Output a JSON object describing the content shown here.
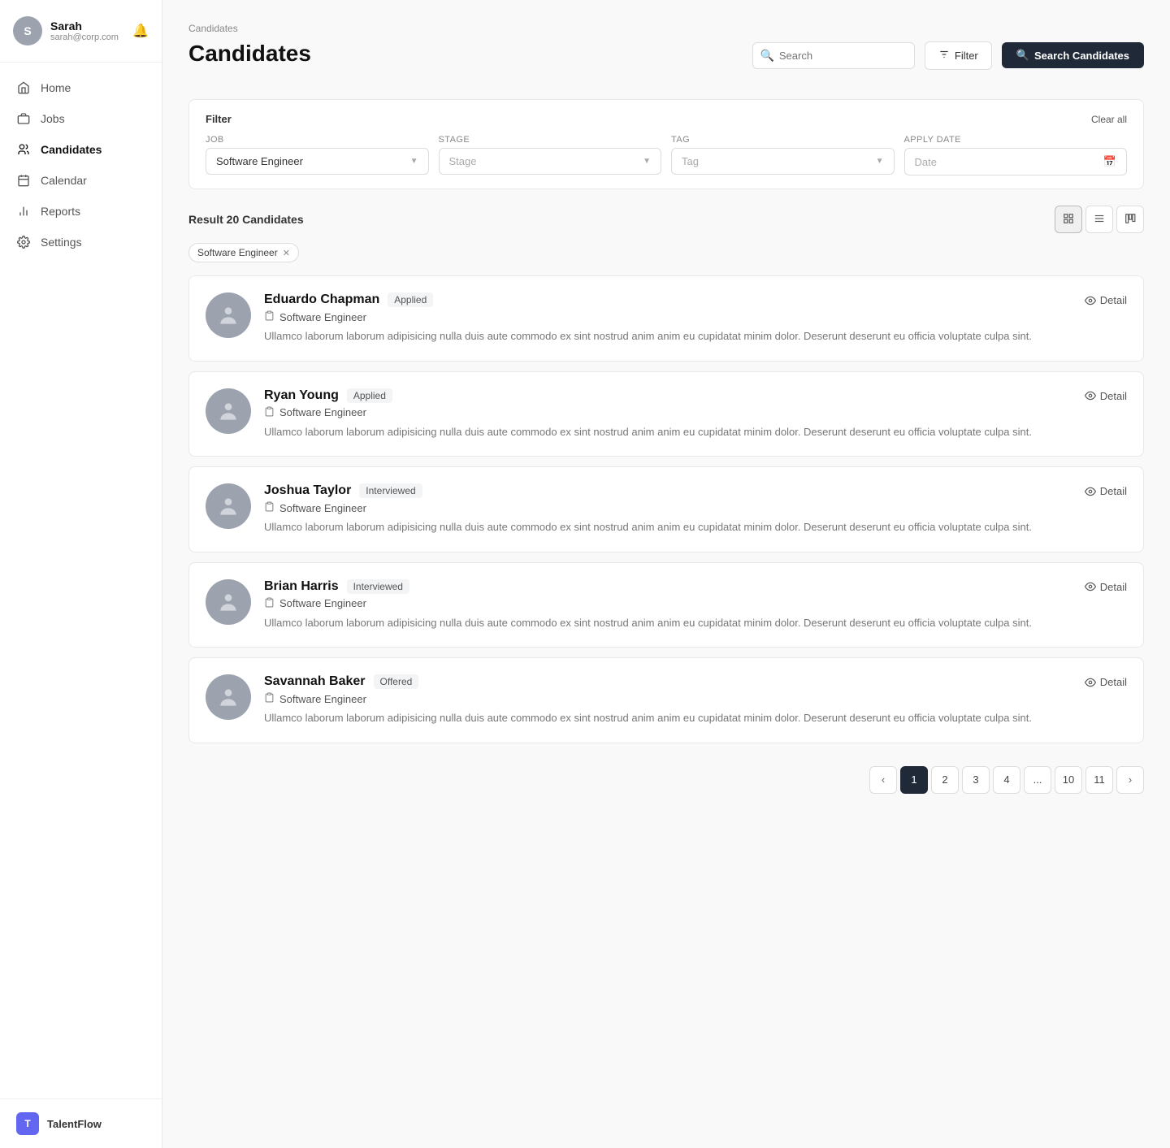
{
  "app": {
    "name": "TalentFlow",
    "logo_letter": "T"
  },
  "user": {
    "name": "Sarah",
    "email": "sarah@corp.com",
    "avatar_letter": "S"
  },
  "sidebar": {
    "items": [
      {
        "id": "home",
        "label": "Home",
        "icon": "home"
      },
      {
        "id": "jobs",
        "label": "Jobs",
        "icon": "briefcase"
      },
      {
        "id": "candidates",
        "label": "Candidates",
        "icon": "candidates",
        "active": true
      },
      {
        "id": "calendar",
        "label": "Calendar",
        "icon": "calendar"
      },
      {
        "id": "reports",
        "label": "Reports",
        "icon": "reports"
      },
      {
        "id": "settings",
        "label": "Settings",
        "icon": "settings"
      }
    ]
  },
  "header": {
    "breadcrumb": "Candidates",
    "title": "Candidates"
  },
  "toolbar": {
    "search_placeholder": "Search",
    "filter_label": "Filter",
    "search_candidates_label": "Search Candidates"
  },
  "filter": {
    "label": "Filter",
    "clear_all": "Clear all",
    "fields": [
      {
        "id": "job",
        "label": "Job",
        "value": "Software Engineer",
        "placeholder": ""
      },
      {
        "id": "stage",
        "label": "Stage",
        "value": "",
        "placeholder": "Stage"
      },
      {
        "id": "tag",
        "label": "Tag",
        "value": "",
        "placeholder": "Tag"
      },
      {
        "id": "apply_date",
        "label": "Apply Date",
        "value": "",
        "placeholder": "Date"
      }
    ]
  },
  "results": {
    "text": "Result 20 Candidates",
    "active_filters": [
      {
        "label": "Software Engineer"
      }
    ]
  },
  "candidates": [
    {
      "name": "Eduardo Chapman",
      "status": "Applied",
      "job": "Software Engineer",
      "bio": "Ullamco laborum laborum adipisicing nulla duis aute commodo ex sint nostrud anim anim eu cupidatat minim dolor. Deserunt deserunt eu officia voluptate culpa sint."
    },
    {
      "name": "Ryan Young",
      "status": "Applied",
      "job": "Software Engineer",
      "bio": "Ullamco laborum laborum adipisicing nulla duis aute commodo ex sint nostrud anim anim eu cupidatat minim dolor. Deserunt deserunt eu officia voluptate culpa sint."
    },
    {
      "name": "Joshua Taylor",
      "status": "Interviewed",
      "job": "Software Engineer",
      "bio": "Ullamco laborum laborum adipisicing nulla duis aute commodo ex sint nostrud anim anim eu cupidatat minim dolor. Deserunt deserunt eu officia voluptate culpa sint."
    },
    {
      "name": "Brian Harris",
      "status": "Interviewed",
      "job": "Software Engineer",
      "bio": "Ullamco laborum laborum adipisicing nulla duis aute commodo ex sint nostrud anim anim eu cupidatat minim dolor. Deserunt deserunt eu officia voluptate culpa sint."
    },
    {
      "name": "Savannah Baker",
      "status": "Offered",
      "job": "Software Engineer",
      "bio": "Ullamco laborum laborum adipisicing nulla duis aute commodo ex sint nostrud anim anim eu cupidatat minim dolor. Deserunt deserunt eu officia voluptate culpa sint."
    }
  ],
  "detail_label": "Detail",
  "pagination": {
    "current": 1,
    "pages": [
      "1",
      "2",
      "3",
      "4",
      "...",
      "10",
      "11"
    ]
  }
}
